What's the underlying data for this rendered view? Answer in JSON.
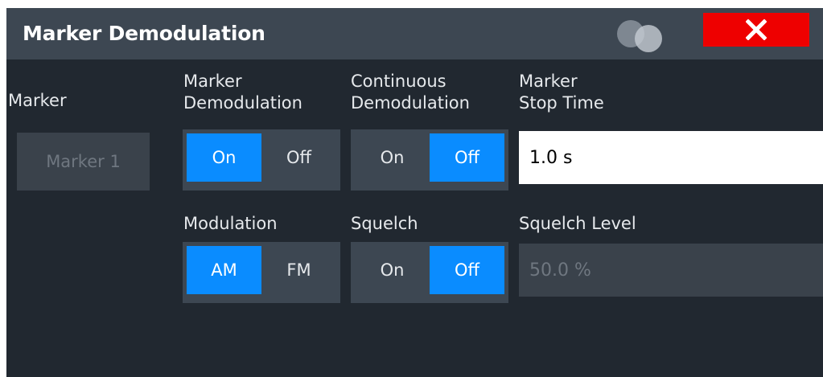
{
  "dialog": {
    "title": "Marker Demodulation",
    "close_label": "X"
  },
  "marker": {
    "label": "Marker",
    "selected": "Marker 1"
  },
  "marker_demodulation": {
    "label_line1": "Marker",
    "label_line2": "Demodulation",
    "options": [
      "On",
      "Off"
    ],
    "selected": "On"
  },
  "continuous_demodulation": {
    "label_line1": "Continuous",
    "label_line2": "Demodulation",
    "options": [
      "On",
      "Off"
    ],
    "selected": "Off"
  },
  "marker_stop_time": {
    "label_line1": "Marker",
    "label_line2": "Stop Time",
    "value": "1.0 s"
  },
  "modulation": {
    "label": "Modulation",
    "options": [
      "AM",
      "FM"
    ],
    "selected": "AM"
  },
  "squelch": {
    "label": "Squelch",
    "options": [
      "On",
      "Off"
    ],
    "selected": "Off"
  },
  "squelch_level": {
    "label": "Squelch Level",
    "value": "50.0 %"
  },
  "colors": {
    "background": "#212830",
    "title_bar": "#3d4752",
    "active_option": "#0a8cff",
    "close_button": "#ee0000"
  },
  "icons": {
    "help": "help-icon",
    "close": "close-icon"
  }
}
